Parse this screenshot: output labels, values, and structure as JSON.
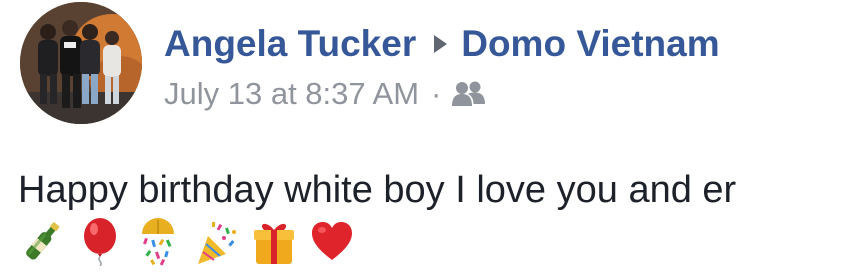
{
  "post": {
    "author": "Angela Tucker",
    "target": "Domo Vietnam",
    "timestamp": "July 13 at 8:37 AM",
    "separator": "·",
    "audience_icon": "friends-icon",
    "message": "Happy birthday white boy I love you and er",
    "emojis": [
      "champagne-icon",
      "balloon-icon",
      "confetti-ball-icon",
      "party-popper-icon",
      "gift-icon",
      "red-heart-icon"
    ]
  },
  "colors": {
    "name": "#365899",
    "meta": "#90949c",
    "text": "#1d2129"
  }
}
